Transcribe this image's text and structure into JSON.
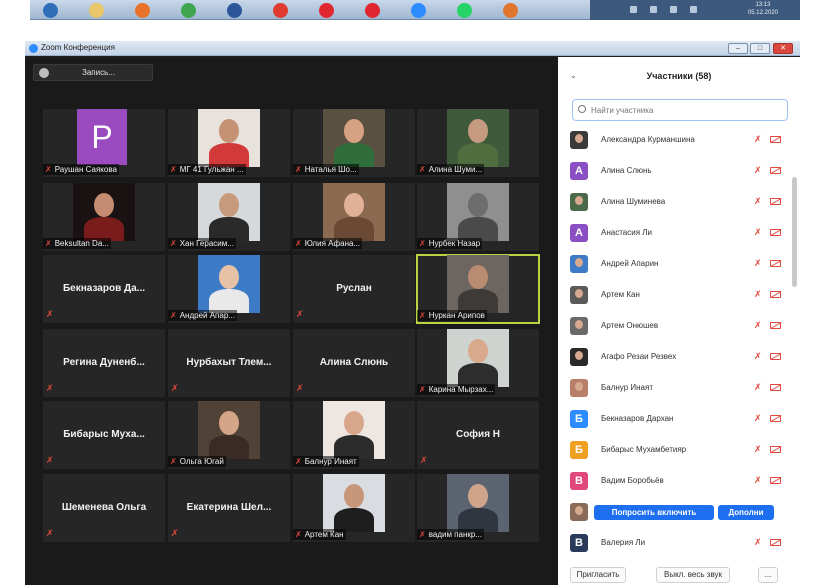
{
  "taskbar": {
    "clock_time": "13:13",
    "clock_date": "05.12.2020",
    "icons": [
      {
        "icon": "windows-start-icon",
        "color": "#2f6fb8"
      },
      {
        "icon": "folder-icon",
        "color": "#e9c66a"
      },
      {
        "icon": "firefox-icon",
        "color": "#e8722a"
      },
      {
        "icon": "chrome-icon",
        "color": "#3fa64f"
      },
      {
        "icon": "word-icon",
        "color": "#2b579a"
      },
      {
        "icon": "yandex-icon",
        "color": "#e03b2f"
      },
      {
        "icon": "opera-icon",
        "color": "#e0262e"
      },
      {
        "icon": "opera-icon",
        "color": "#e0262e"
      },
      {
        "icon": "zoom-icon",
        "color": "#2d8cff"
      },
      {
        "icon": "whatsapp-icon",
        "color": "#25d366"
      },
      {
        "icon": "photo-viewer-icon",
        "color": "#e0762e"
      }
    ]
  },
  "window": {
    "title": "Zoom Конференция"
  },
  "recording": {
    "label": "Запись..."
  },
  "tiles": [
    {
      "name": "Раушан Саякова",
      "type": "avatar",
      "letter": "P",
      "color": "#9a4bbf"
    },
    {
      "name": "МГ 41 Гульжан ...",
      "type": "photo",
      "bg": "#e8e2dc",
      "skin": "#c69274",
      "cloth": "#d23a3a"
    },
    {
      "name": "Наталья Шо...",
      "type": "photo",
      "bg": "#5a5042",
      "skin": "#d7a283",
      "cloth": "#2f6e3a"
    },
    {
      "name": "Алина Шуми...",
      "type": "photo",
      "bg": "#3f5a3a",
      "skin": "#c59a80",
      "cloth": "#4f6d3f"
    },
    {
      "name": "Beksultan Da...",
      "type": "photo",
      "bg": "#1a1212",
      "skin": "#c48d72",
      "cloth": "#7a1c1c"
    },
    {
      "name": "Хан Герасим...",
      "type": "photo",
      "bg": "#d6d9dc",
      "skin": "#c79a7c",
      "cloth": "#2a2a2a"
    },
    {
      "name": "Юлия Афана...",
      "type": "photo",
      "bg": "#8b6a52",
      "skin": "#e1b197",
      "cloth": "#6b4a35"
    },
    {
      "name": "Нурбек Назар",
      "type": "photo",
      "bg": "#8f8f8f",
      "skin": "#6d6d6d",
      "cloth": "#4a4a4a"
    },
    {
      "name": "Бекназаров Да...",
      "type": "name"
    },
    {
      "name": "Андрей Апар...",
      "type": "photo",
      "bg": "#3d7bc6",
      "skin": "#e8c2a6",
      "cloth": "#e9e9e9"
    },
    {
      "name": "Руслан",
      "type": "name"
    },
    {
      "name": "Нуркан Арипов",
      "type": "photo",
      "bg": "#6d6660",
      "skin": "#b98c72",
      "cloth": "#3e3a38",
      "active": true
    },
    {
      "name": "Регина Дуненб...",
      "type": "name"
    },
    {
      "name": "Нурбахыт Тлем...",
      "type": "name"
    },
    {
      "name": "Алина Слюнь",
      "type": "name"
    },
    {
      "name": "Карина Мырзах...",
      "type": "photo",
      "bg": "#cfd3d0",
      "skin": "#d9a98c",
      "cloth": "#2d2d2d"
    },
    {
      "name": "Бибарыс Муха...",
      "type": "name"
    },
    {
      "name": "Ольга Югай",
      "type": "photo",
      "bg": "#514238",
      "skin": "#d5a588",
      "cloth": "#3a2c24"
    },
    {
      "name": "Балнур Инаят",
      "type": "photo",
      "bg": "#eee7e1",
      "skin": "#d8a78b",
      "cloth": "#2c2c2c"
    },
    {
      "name": "София Н",
      "type": "name"
    },
    {
      "name": "Шеменева Ольга",
      "type": "name"
    },
    {
      "name": "Екатерина Шел...",
      "type": "name"
    },
    {
      "name": "Артем Кан",
      "type": "photo",
      "bg": "#d9dde2",
      "skin": "#c8977a",
      "cloth": "#1e1e1e"
    },
    {
      "name": "вадим панкр...",
      "type": "photo",
      "bg": "#5b6470",
      "skin": "#d0a48a",
      "cloth": "#2f3640"
    }
  ],
  "panel": {
    "collapse_icon": "chevron-down-icon",
    "title": "Участники (58)",
    "search_placeholder": "Найти участника",
    "participants": [
      {
        "name": "Александра Курманшина",
        "avatar_type": "photo",
        "color": "#3a3a3a"
      },
      {
        "name": "Алина Слюнь",
        "avatar_type": "letter",
        "letter": "А",
        "color": "#8b4fc4"
      },
      {
        "name": "Алина Шуминева",
        "avatar_type": "photo",
        "color": "#4a6a4a"
      },
      {
        "name": "Анастасия Ли",
        "avatar_type": "letter",
        "letter": "А",
        "color": "#8b4fc4"
      },
      {
        "name": "Андрей Апарин",
        "avatar_type": "photo",
        "color": "#3d7bc6"
      },
      {
        "name": "Артем Кан",
        "avatar_type": "photo",
        "color": "#5a5a5a"
      },
      {
        "name": "Артем Онюшев",
        "avatar_type": "photo",
        "color": "#6a6a6a"
      },
      {
        "name": "Агафо Резаи Резвех",
        "avatar_type": "photo",
        "color": "#2a2a2a"
      },
      {
        "name": "Балнур Инаят",
        "avatar_type": "photo",
        "color": "#b97f6a"
      },
      {
        "name": "Бекназаров Дархан",
        "avatar_type": "letter",
        "letter": "Б",
        "color": "#2d8cff"
      },
      {
        "name": "Бибарыс Мухамбетияр",
        "avatar_type": "letter",
        "letter": "Б",
        "color": "#f0a020"
      },
      {
        "name": "Вадим Боробьёв",
        "avatar_type": "letter",
        "letter": "В",
        "color": "#e0477a"
      },
      {
        "name": "",
        "avatar_type": "photo",
        "color": "#8a6a58",
        "buttons": [
          "Попросить включить",
          "Дополни"
        ]
      },
      {
        "name": "Валерия Ли",
        "avatar_type": "letter",
        "letter": "В",
        "color": "#2a3a5a"
      }
    ],
    "footer": {
      "invite": "Пригласить",
      "mute_all": "Выкл. весь звук",
      "more": "..."
    }
  }
}
